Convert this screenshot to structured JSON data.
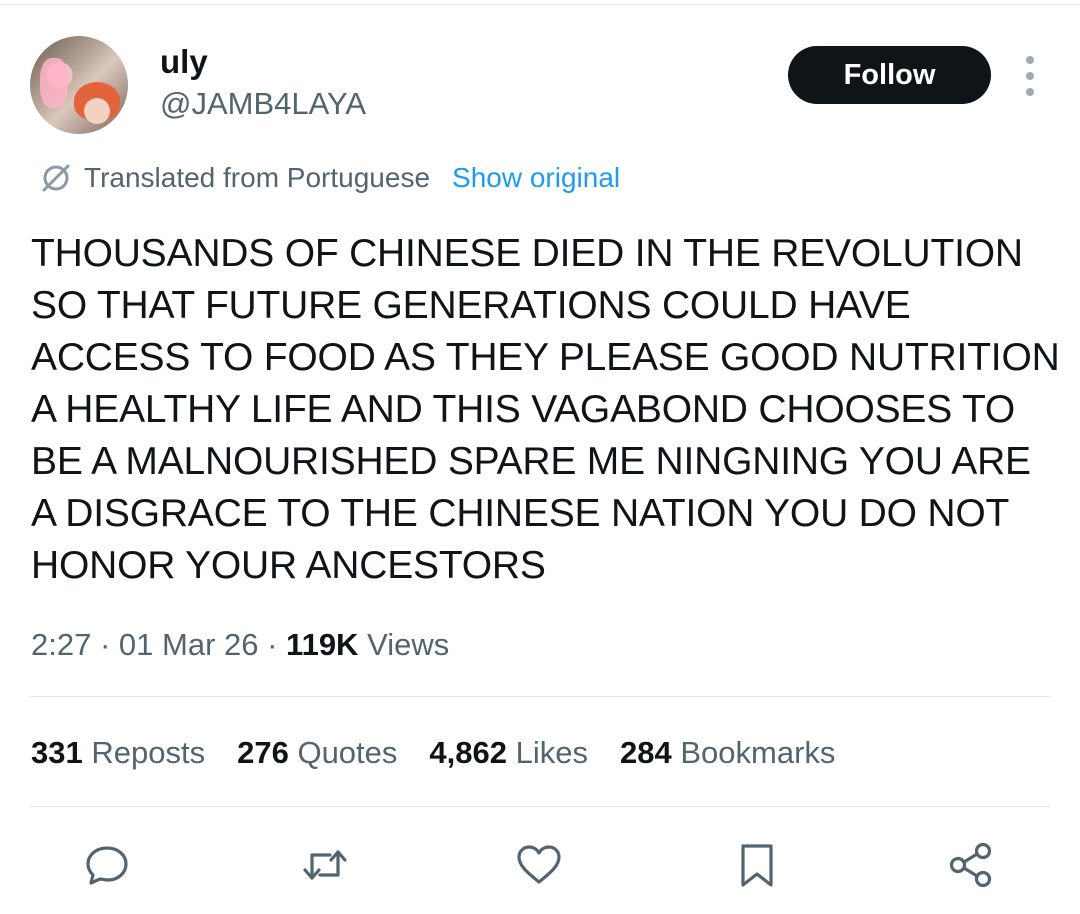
{
  "author": {
    "display_name": "uly",
    "handle": "@JAMB4LAYA"
  },
  "follow_button": {
    "label": "Follow"
  },
  "more_menu": {
    "icon": "more-vertical-icon"
  },
  "translation": {
    "icon": "translate-icon",
    "label": "Translated from Portuguese",
    "link": "Show original"
  },
  "tweet": {
    "text": "THOUSANDS OF CHINESE DIED IN THE REVOLUTION\nSO THAT FUTURE GENERATIONS COULD HAVE\nACCESS TO FOOD AS THEY PLEASE GOOD NUTRITION\nA HEALTHY LIFE AND THIS VAGABOND CHOOSES TO\nBE A MALNOURISHED SPARE ME NINGNING YOU ARE\nA DISGRACE TO THE CHINESE NATION YOU DO NOT\nHONOR YOUR ANCESTORS"
  },
  "meta": {
    "time": "2:27",
    "separator": " · ",
    "date": "01 Mar 26",
    "views_count": "119K",
    "views_label": "Views"
  },
  "stats": [
    {
      "count": "331",
      "label": "Reposts"
    },
    {
      "count": "276",
      "label": "Quotes"
    },
    {
      "count": "4,862",
      "label": "Likes"
    },
    {
      "count": "284",
      "label": "Bookmarks"
    }
  ],
  "actions": [
    "reply-icon",
    "repost-icon",
    "like-icon",
    "bookmark-icon",
    "share-icon"
  ],
  "colors": {
    "text": "#0f1419",
    "secondary": "#536471",
    "link": "#1d9bf0",
    "button": "#0f1419"
  }
}
